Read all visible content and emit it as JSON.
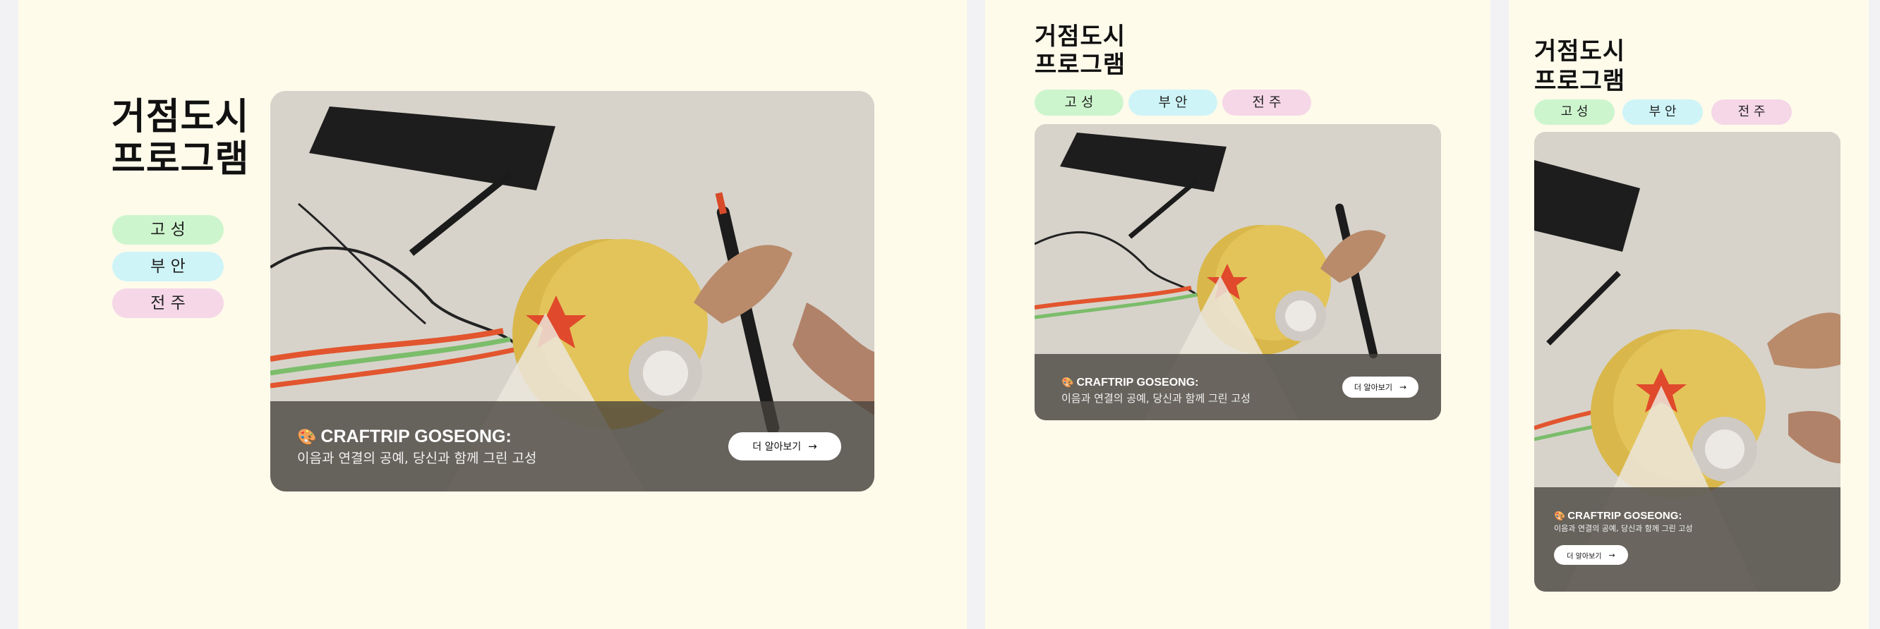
{
  "title_line1": "거점도시",
  "title_line2": "프로그램",
  "cities": [
    "고 성",
    "부 안",
    "전 주"
  ],
  "colors": {
    "background": "#fffbeb",
    "tag_green": "#cdf5cd",
    "tag_blue": "#cef4f7",
    "tag_pink": "#f5d7e7"
  },
  "card": {
    "emoji": "🎨",
    "title": "CRAFTRIP GOSEONG:",
    "subtitle": "이음과 연결의 공예, 당신과 함께 그린 고성",
    "button_label": "더 알아보기",
    "arrow": "→"
  }
}
